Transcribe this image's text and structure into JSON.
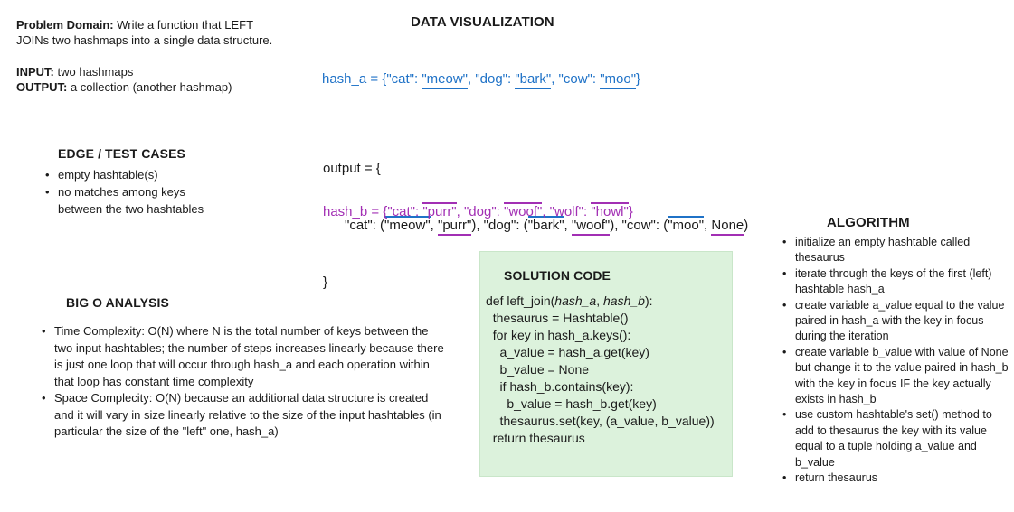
{
  "problem": {
    "domain_label": "Problem Domain:",
    "domain_text_1": " Write a function that LEFT",
    "domain_text_2": "JOINs two hashmaps into a single data structure.",
    "input_label": "INPUT:",
    "input_text": " two hashmaps",
    "output_label": "OUTPUT:",
    "output_text": " a collection (another hashmap)"
  },
  "viz": {
    "title": "DATA VISUALIZATION",
    "hash_a": {
      "prefix": "hash_a = {\"cat\": ",
      "v1": "\"meow\"",
      "mid1": ", \"dog\": ",
      "v2": "\"bark\"",
      "mid2": ", \"cow\": ",
      "v3": "\"moo\"",
      "suffix": "}"
    },
    "output": {
      "line1": "output = {",
      "p1": "\"cat\": (",
      "a1": "\"meow\"",
      "c1": ", ",
      "b1": "\"purr\"",
      "p2": "), \"dog\": (",
      "a2": "\"bark\"",
      "c2": ", ",
      "b2": "\"woof\"",
      "p3": "), \"cow\": (",
      "a3": "\"moo\"",
      "c3": ", ",
      "b3": "None",
      "p4": ")",
      "line3": "}"
    },
    "hash_b": {
      "prefix": "hash_b = {\"cat\": ",
      "v1": "\"purr\"",
      "mid1": ", \"dog\": ",
      "v2": "\"woof\"",
      "mid2": ", \"wolf\": ",
      "v3": "\"howl\"",
      "suffix": "}"
    }
  },
  "edge": {
    "title": "EDGE / TEST CASES",
    "items": [
      "empty hashtable(s)",
      "no matches among keys between the two hashtables"
    ]
  },
  "bigo": {
    "title": "BIG O ANALYSIS",
    "items": [
      "Time Complexity: O(N) where N is the total number of keys between the two input hashtables; the number of steps increases linearly because there is just one loop that will occur through hash_a and each operation within that loop has constant time complexity",
      "Space Complecity: O(N) because an additional data structure is created and it will vary in size linearly relative to the size of the input hashtables (in particular the size of the \"left\" one, hash_a)"
    ]
  },
  "solution": {
    "title": "SOLUTION CODE",
    "def_prefix": "def left_join(",
    "param_a": "hash_a",
    "param_sep": ", ",
    "param_b": "hash_b",
    "def_suffix": "):",
    "lines": [
      "  thesaurus = Hashtable()",
      "  for key in hash_a.keys():",
      "    a_value = hash_a.get(key)",
      "    b_value = None",
      "    if hash_b.contains(key):",
      "      b_value = hash_b.get(key)",
      "    thesaurus.set(key, (a_value, b_value))",
      "  return thesaurus"
    ]
  },
  "algorithm": {
    "title": "ALGORITHM",
    "items": [
      "initialize an empty hashtable called thesaurus",
      "iterate through the keys of the first (left) hashtable hash_a",
      "create variable a_value equal to the value paired in hash_a with the key in focus during the iteration",
      "create variable b_value with value of None but change it to the value paired in hash_b with the key in focus IF the key actually exists in hash_b",
      "use custom hashtable's set() method to add to thesaurus the key with its value equal to a tuple holding a_value and b_value",
      "return thesaurus"
    ]
  },
  "colors": {
    "hash_a": "#1f72c7",
    "hash_b": "#a22fb4",
    "code_box": "#dcf2dc"
  }
}
